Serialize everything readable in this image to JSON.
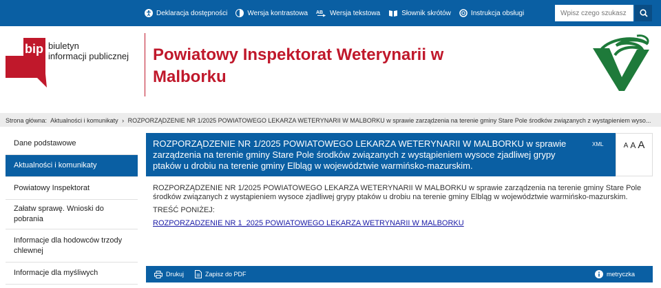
{
  "topbar": {
    "links": [
      {
        "label": "Deklaracja dostępności",
        "icon": "accessibility-icon"
      },
      {
        "label": "Wersja kontrastowa",
        "icon": "contrast-icon"
      },
      {
        "label": "Wersja tekstowa",
        "icon": "text-version-icon"
      },
      {
        "label": "Słownik skrótów",
        "icon": "book-icon"
      },
      {
        "label": "Instrukcja obsługi",
        "icon": "help-lifebuoy-icon"
      }
    ],
    "search_placeholder": "Wpisz czego szukasz"
  },
  "header": {
    "bip_line1": "biuletyn",
    "bip_line2": "informacji publicznej",
    "bip_logo_text": "bip",
    "org_title": "Powiatowy Inspektorat Weterynarii w Malborku",
    "brand_color": "#c0182b",
    "accent_color": "#0a5fa3"
  },
  "breadcrumb": {
    "home": "Strona główna:",
    "section": "Aktualności i komunikaty",
    "separator": "›",
    "current": "ROZPORZĄDZENIE NR 1/2025 POWIATOWEGO LEKARZA WETERYNARII W MALBORKU w sprawie zarządzenia na terenie gminy Stare Pole środków związanych z wystąpieniem wyso..."
  },
  "sidebar": {
    "items": [
      {
        "label": "Dane podstawowe"
      },
      {
        "label": "Aktualności i komunikaty",
        "active": true
      },
      {
        "label": "Powiatowy Inspektorat"
      },
      {
        "label": "Załatw sprawę. Wnioski do pobrania"
      },
      {
        "label": "Informacje dla hodowców trzody chlewnej"
      },
      {
        "label": "Informacje dla myśliwych"
      }
    ]
  },
  "article": {
    "title": "ROZPORZĄDZENIE NR 1/2025 POWIATOWEGO LEKARZA WETERYNARII W MALBORKU w sprawie zarządzenia na terenie gminy Stare Pole środków związanych z wystąpieniem wysoce zjadliwej grypy ptaków u drobiu na terenie gminy Elbląg w województwie warmińsko-mazurskim.",
    "xml_label": "XML",
    "font_small": "A",
    "font_medium": "A",
    "font_large": "A",
    "body_text": "ROZPORZĄDZENIE NR 1/2025 POWIATOWEGO LEKARZA WETERYNARII W MALBORKU w sprawie zarządzenia na terenie gminy Stare Pole środków związanych z wystąpieniem wysoce zjadliwej grypy ptaków u drobiu na terenie gminy Elbląg w województwie warmińsko-mazurskim.",
    "content_heading": "TREŚĆ PONIŻEJ:",
    "attachment_link": "ROZPORZADZENIE NR 1_2025 POWIATOWEGO LEKARZA WETRYNARII W MALBORKU"
  },
  "bottombar": {
    "print_label": "Drukuj",
    "pdf_label": "Zapisz do PDF",
    "metrics_label": "metryczka"
  }
}
